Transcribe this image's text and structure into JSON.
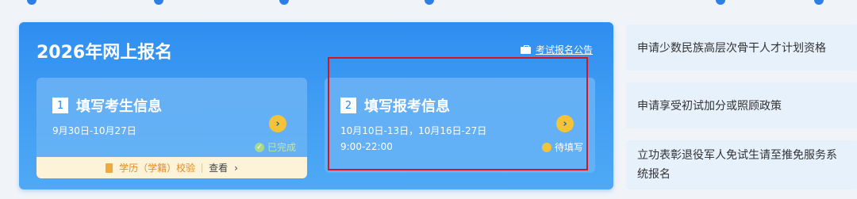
{
  "panel": {
    "title": "2026年网上报名",
    "notice_label": "考试报名公告"
  },
  "steps": [
    {
      "number": "1",
      "title": "填写考生信息",
      "date": "9月30日-10月27日",
      "status": "已完成",
      "verify_label": "学历（学籍）校验",
      "view_label": "查看"
    },
    {
      "number": "2",
      "title": "填写报考信息",
      "date": "10月10日-13日，10月16日-27日",
      "time": "9:00-22:00",
      "status": "待填写"
    }
  ],
  "sidebar": {
    "items": [
      {
        "label": "申请少数民族高层次骨干人才计划资格"
      },
      {
        "label": "申请享受初试加分或照顾政策"
      },
      {
        "label_line1": "立功表彰退役军人免试生请至推免服务系",
        "label_line2": "统报名"
      }
    ]
  },
  "colors": {
    "panel_blue": "#2e8df0",
    "button_yellow": "#f5c338",
    "done_green": "#a8d98a",
    "highlight_red": "#d9141a",
    "sidebar_bg": "#e6f1fc"
  },
  "icons": [
    "notice-icon",
    "arrow-right-icon",
    "check-circle-icon",
    "pending-circle-icon",
    "document-icon",
    "chevron-right-icon"
  ]
}
